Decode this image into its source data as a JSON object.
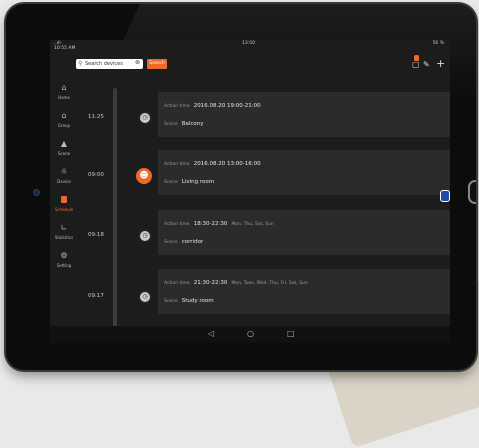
{
  "statusbar": {
    "left": "..ıll",
    "time_small": "10:55 AM",
    "center": "13:50",
    "right": "56 %"
  },
  "search": {
    "placeholder": "Search devices",
    "button_label": "Search"
  },
  "nav": {
    "items": [
      {
        "label": "Home",
        "icon": "home-icon"
      },
      {
        "label": "Group",
        "icon": "group-icon"
      },
      {
        "label": "Scene",
        "icon": "scene-icon"
      },
      {
        "label": "Device",
        "icon": "device-icon"
      },
      {
        "label": "Schedule",
        "icon": "schedule-icon",
        "active": true
      },
      {
        "label": "Statistics",
        "icon": "statistics-icon"
      },
      {
        "label": "Setting",
        "icon": "setting-icon"
      }
    ]
  },
  "schedule": {
    "action_label": "Action time",
    "scene_label": "Scene",
    "entries": [
      {
        "time": "11:25",
        "action_time": "2016.08.20 19:00-21:00",
        "days": "",
        "scene": "Balcony"
      },
      {
        "time": "09:00",
        "action_time": "2016.08.20 13:00-16:00",
        "days": "",
        "scene": "Living room"
      },
      {
        "time": "09:18",
        "action_time": "18:30-22:30",
        "days": "Mon, Thu, Sat, Sun",
        "scene": "corridor"
      },
      {
        "time": "09:17",
        "action_time": "21:30-22:30",
        "days": "Mon, Tues, Wed, Thu, Fri, Sat, Sun",
        "scene": "Study room"
      }
    ]
  },
  "accent_color": "#ee6a29"
}
